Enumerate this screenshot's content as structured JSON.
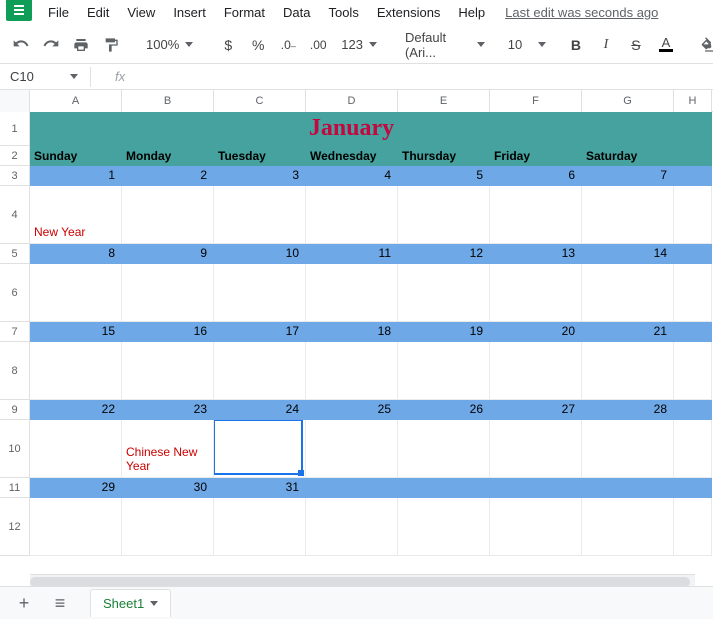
{
  "menu": {
    "items": [
      "File",
      "Edit",
      "View",
      "Insert",
      "Format",
      "Data",
      "Tools",
      "Extensions",
      "Help"
    ],
    "last_edit": "Last edit was seconds ago"
  },
  "toolbar": {
    "zoom": "100%",
    "font": "Default (Ari...",
    "font_size": "10",
    "format_123": "123"
  },
  "name_box": "C10",
  "columns": [
    "A",
    "B",
    "C",
    "D",
    "E",
    "F",
    "G",
    "H"
  ],
  "rows": {
    "labels": [
      "1",
      "2",
      "3",
      "4",
      "5",
      "6",
      "7",
      "8",
      "9",
      "10",
      "11",
      "12"
    ]
  },
  "calendar": {
    "month": "January",
    "day_headers": [
      "Sunday",
      "Monday",
      "Tuesday",
      "Wednesday",
      "Thursday",
      "Friday",
      "Saturday"
    ],
    "weeks": [
      {
        "nums": [
          "1",
          "2",
          "3",
          "4",
          "5",
          "6",
          "7"
        ],
        "events": [
          "New Year",
          "",
          "",
          "",
          "",
          "",
          ""
        ]
      },
      {
        "nums": [
          "8",
          "9",
          "10",
          "11",
          "12",
          "13",
          "14"
        ],
        "events": [
          "",
          "",
          "",
          "",
          "",
          "",
          ""
        ]
      },
      {
        "nums": [
          "15",
          "16",
          "17",
          "18",
          "19",
          "20",
          "21"
        ],
        "events": [
          "",
          "",
          "",
          "",
          "",
          "",
          ""
        ]
      },
      {
        "nums": [
          "22",
          "23",
          "24",
          "25",
          "26",
          "27",
          "28"
        ],
        "events": [
          "",
          "Chinese New Year",
          "",
          "",
          "",
          "",
          ""
        ]
      },
      {
        "nums": [
          "29",
          "30",
          "31",
          "",
          "",
          "",
          ""
        ],
        "events": [
          "",
          "",
          "",
          "",
          "",
          "",
          ""
        ]
      }
    ]
  },
  "tabs": {
    "sheet1": "Sheet1"
  }
}
